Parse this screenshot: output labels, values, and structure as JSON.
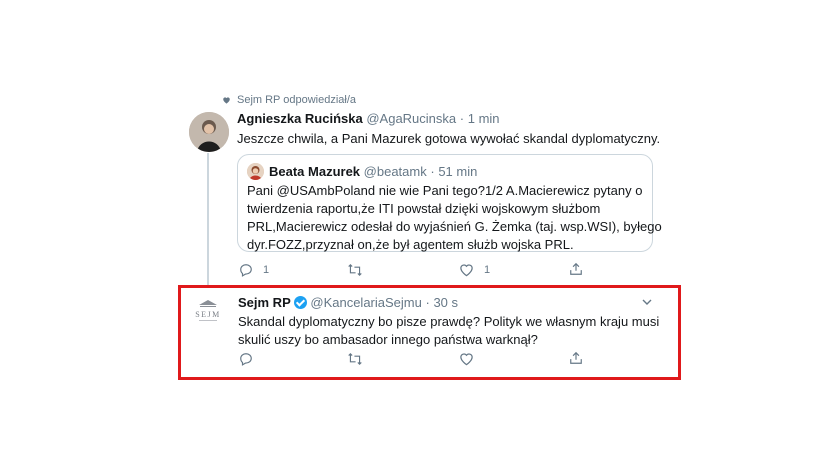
{
  "context": {
    "replied_label": "Sejm RP odpowiedział/a"
  },
  "tweet1": {
    "author_name": "Agnieszka Rucińska",
    "handle": "@AgaRucinska",
    "separator": "·",
    "time": "1 min",
    "text": "Jeszcze chwila, a Pani Mazurek gotowa wywołać skandal dyplomatyczny.",
    "quoted": {
      "author_name": "Beata Mazurek",
      "handle": "@beatamk",
      "separator": "·",
      "time": "51 min",
      "lines": [
        "Pani @USAmbPoland nie wie Pani tego?1/2 A.Macierewicz pytany o",
        "twierdzenia raportu,że ITI powstał dzięki wojskowym służbom",
        "PRL,Macierewicz odesłał do wyjaśnień G. Żemka (taj. wsp.WSI), byłego",
        "dyr.FOZZ,przyznał on,że był agentem służb wojska PRL."
      ]
    },
    "actions": {
      "reply_count": "1",
      "retweet_count": "",
      "like_count": "1"
    }
  },
  "tweet2": {
    "author_name": "Sejm RP",
    "handle": "@KancelariaSejmu",
    "separator": "·",
    "time": "30 s",
    "avatar_text": "SEJM",
    "lines": [
      "Skandal dyplomatyczny bo pisze prawdę? Polityk we własnym kraju musi",
      "skulić uszy bo ambasador innego państwa warknął?"
    ]
  },
  "colors": {
    "accent": "#1da1f2",
    "highlight": "#e0191b",
    "muted": "#657786"
  }
}
